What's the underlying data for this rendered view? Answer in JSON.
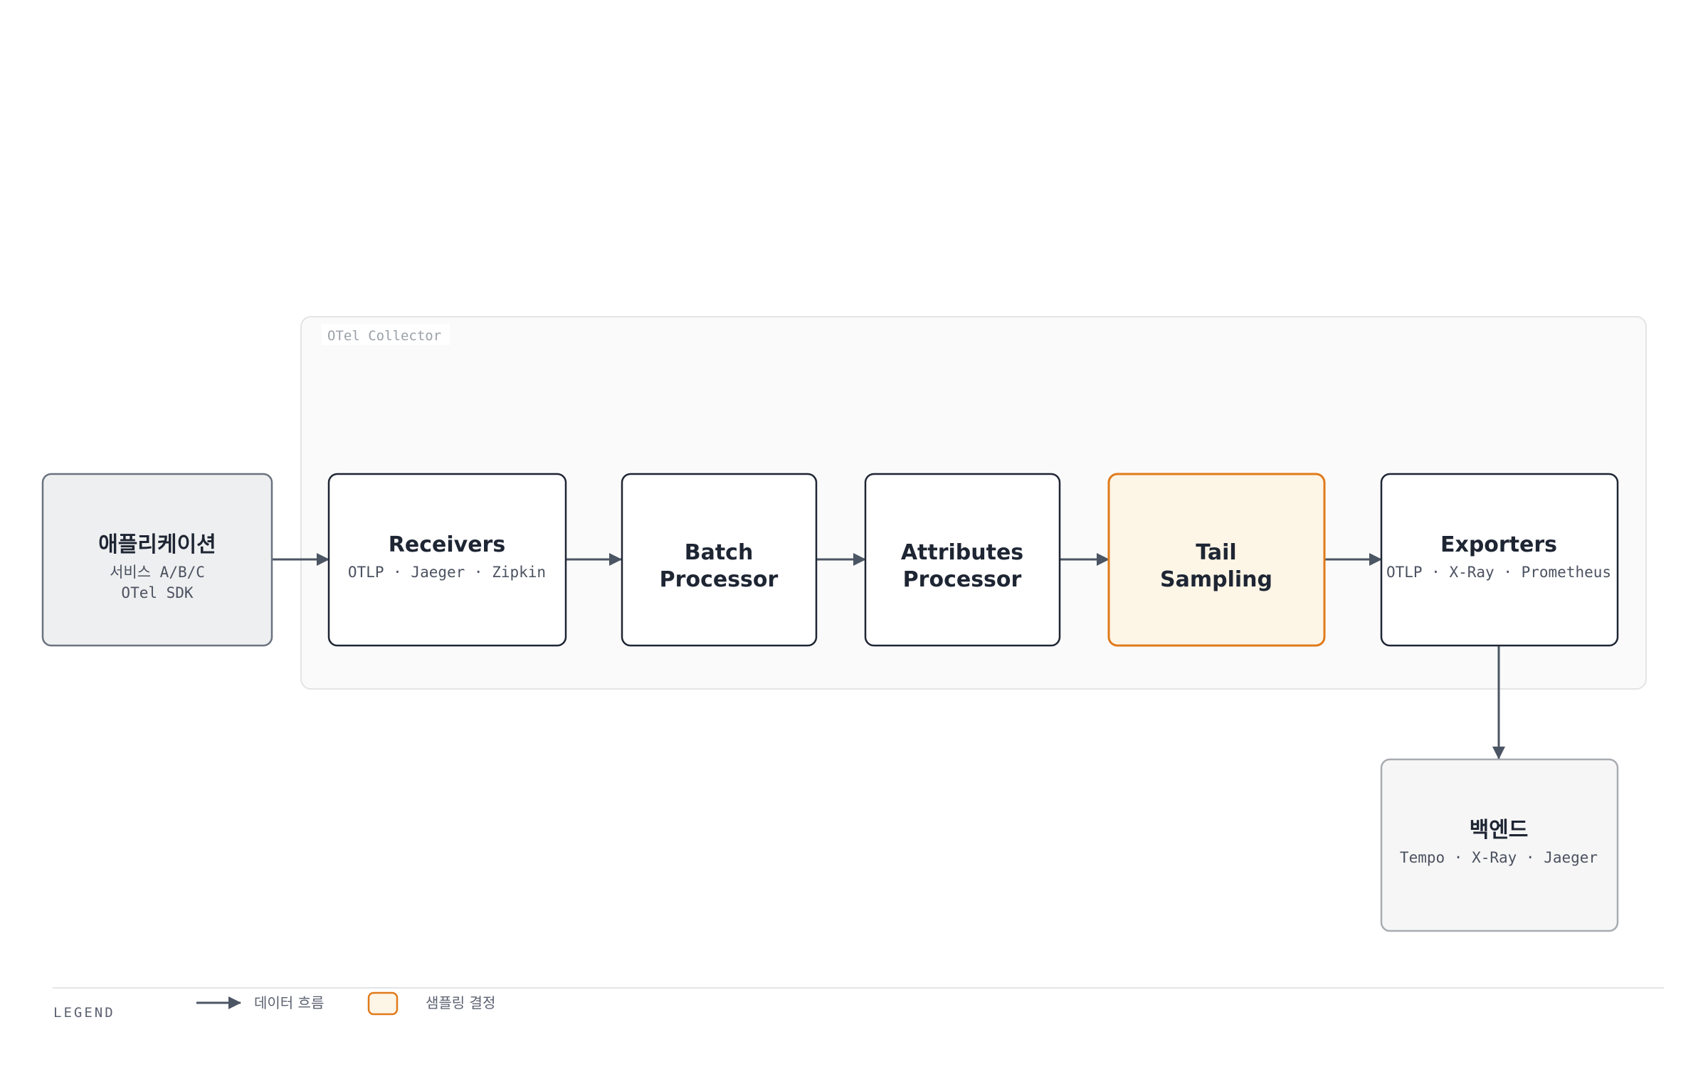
{
  "colors": {
    "edge": "#4b5563",
    "node_stroke": "#1e2533",
    "node_fill": "#ffffff",
    "app_fill": "#eeeff0",
    "app_stroke": "#6b7280",
    "backend_fill": "#f6f6f6",
    "backend_stroke": "#a8abb0",
    "highlight_fill": "#fdf5e6",
    "highlight_stroke": "#e07a1a",
    "group_fill": "#fafafa",
    "group_stroke": "#e3e4e6"
  },
  "group": {
    "label": "OTel Collector"
  },
  "nodes": {
    "app": {
      "title": "애플리케이션",
      "sub1": "서비스 A/B/C",
      "sub2": "OTel SDK"
    },
    "receivers": {
      "title": "Receivers",
      "sub1": "OTLP · Jaeger · Zipkin"
    },
    "batch": {
      "title1": "Batch",
      "title2": "Processor"
    },
    "attributes": {
      "title1": "Attributes",
      "title2": "Processor"
    },
    "tail": {
      "title1": "Tail",
      "title2": "Sampling"
    },
    "exporters": {
      "title": "Exporters",
      "sub1": "OTLP · X-Ray · Prometheus"
    },
    "backend": {
      "title": "백엔드",
      "sub1": "Tempo · X-Ray · Jaeger"
    }
  },
  "legend": {
    "title": "LEGEND",
    "items": [
      {
        "icon": "arrow-icon",
        "label": "데이터 흐름"
      },
      {
        "icon": "highlight-box-icon",
        "label": "샘플링 결정"
      }
    ]
  }
}
